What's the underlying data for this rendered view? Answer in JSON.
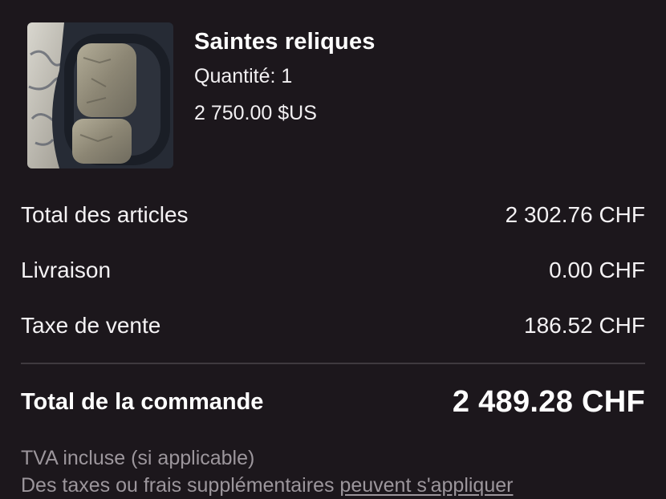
{
  "product": {
    "title": "Saintes reliques",
    "quantity": "Quantité: 1",
    "price": "2 750.00 $US",
    "image_icon": "relic-stone-image"
  },
  "summary": {
    "rows": [
      {
        "label": "Total des articles",
        "value": "2 302.76 CHF"
      },
      {
        "label": "Livraison",
        "value": "0.00 CHF"
      },
      {
        "label": "Taxe de vente",
        "value": "186.52 CHF"
      }
    ],
    "total_label": "Total de la commande",
    "total_value": "2 489.28 CHF"
  },
  "notes": {
    "vat": "TVA incluse (si applicable)",
    "extra_prefix": "Des taxes ou frais supplémentaires",
    "extra_link": "peuvent s'appliquer"
  },
  "colors": {
    "background": "#1c171c",
    "text": "#ffffff",
    "muted": "#9c969c",
    "divider": "#3f3a3f"
  }
}
